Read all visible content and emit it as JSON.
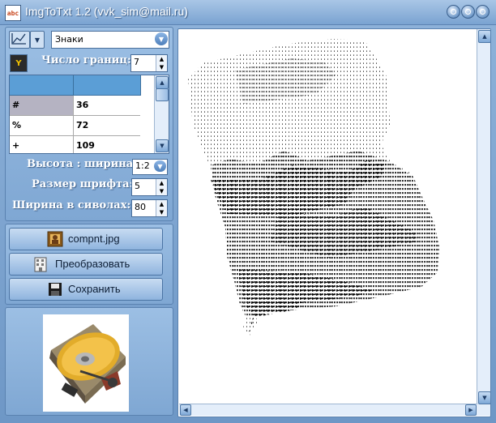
{
  "window": {
    "title": "ImgToTxt 1.2 (vvk_sim@mail.ru)",
    "accent": "#7aa3d1"
  },
  "toolbar": {
    "mode_value": "Знаки"
  },
  "settings": {
    "bounds_label": "Число границ:",
    "bounds_value": "7",
    "table": {
      "columns": [
        "",
        ""
      ],
      "rows": [
        {
          "char": "#",
          "value": "36"
        },
        {
          "char": "%",
          "value": "72"
        },
        {
          "char": "+",
          "value": "109"
        }
      ]
    },
    "ratio_label": "Высота : ширина",
    "ratio_value": "1:2",
    "font_size_label": "Размер шрифта:",
    "font_size_value": "5",
    "width_label": "Ширина в сиволах:",
    "width_value": "80"
  },
  "actions": {
    "open_label": "compnt.jpg",
    "convert_label": "Преобразовать",
    "save_label": "Сохранить"
  },
  "icons": {
    "app": "app-icon",
    "chart": "chart-icon",
    "palette": "vertical-text-icon",
    "open": "picture-frame-icon",
    "convert": "building-icon",
    "save": "floppy-disk-icon",
    "preview": "hard-drive-image"
  }
}
